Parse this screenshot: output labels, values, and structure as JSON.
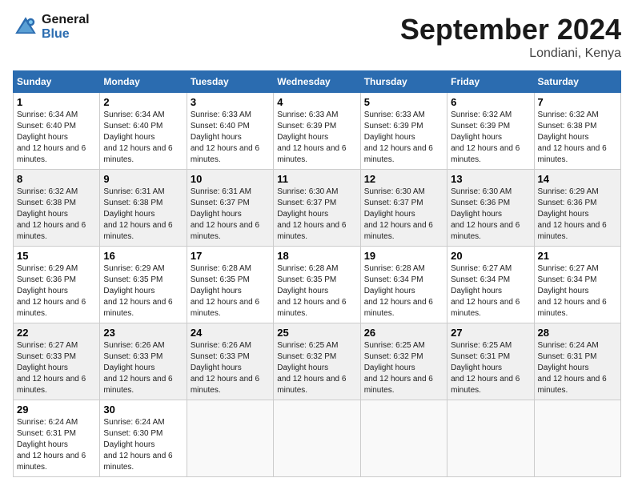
{
  "header": {
    "logo_line1": "General",
    "logo_line2": "Blue",
    "month": "September 2024",
    "location": "Londiani, Kenya"
  },
  "weekdays": [
    "Sunday",
    "Monday",
    "Tuesday",
    "Wednesday",
    "Thursday",
    "Friday",
    "Saturday"
  ],
  "weeks": [
    [
      {
        "day": "1",
        "sunrise": "6:34 AM",
        "sunset": "6:40 PM",
        "daylight": "12 hours and 6 minutes."
      },
      {
        "day": "2",
        "sunrise": "6:34 AM",
        "sunset": "6:40 PM",
        "daylight": "12 hours and 6 minutes."
      },
      {
        "day": "3",
        "sunrise": "6:33 AM",
        "sunset": "6:40 PM",
        "daylight": "12 hours and 6 minutes."
      },
      {
        "day": "4",
        "sunrise": "6:33 AM",
        "sunset": "6:39 PM",
        "daylight": "12 hours and 6 minutes."
      },
      {
        "day": "5",
        "sunrise": "6:33 AM",
        "sunset": "6:39 PM",
        "daylight": "12 hours and 6 minutes."
      },
      {
        "day": "6",
        "sunrise": "6:32 AM",
        "sunset": "6:39 PM",
        "daylight": "12 hours and 6 minutes."
      },
      {
        "day": "7",
        "sunrise": "6:32 AM",
        "sunset": "6:38 PM",
        "daylight": "12 hours and 6 minutes."
      }
    ],
    [
      {
        "day": "8",
        "sunrise": "6:32 AM",
        "sunset": "6:38 PM",
        "daylight": "12 hours and 6 minutes."
      },
      {
        "day": "9",
        "sunrise": "6:31 AM",
        "sunset": "6:38 PM",
        "daylight": "12 hours and 6 minutes."
      },
      {
        "day": "10",
        "sunrise": "6:31 AM",
        "sunset": "6:37 PM",
        "daylight": "12 hours and 6 minutes."
      },
      {
        "day": "11",
        "sunrise": "6:30 AM",
        "sunset": "6:37 PM",
        "daylight": "12 hours and 6 minutes."
      },
      {
        "day": "12",
        "sunrise": "6:30 AM",
        "sunset": "6:37 PM",
        "daylight": "12 hours and 6 minutes."
      },
      {
        "day": "13",
        "sunrise": "6:30 AM",
        "sunset": "6:36 PM",
        "daylight": "12 hours and 6 minutes."
      },
      {
        "day": "14",
        "sunrise": "6:29 AM",
        "sunset": "6:36 PM",
        "daylight": "12 hours and 6 minutes."
      }
    ],
    [
      {
        "day": "15",
        "sunrise": "6:29 AM",
        "sunset": "6:36 PM",
        "daylight": "12 hours and 6 minutes."
      },
      {
        "day": "16",
        "sunrise": "6:29 AM",
        "sunset": "6:35 PM",
        "daylight": "12 hours and 6 minutes."
      },
      {
        "day": "17",
        "sunrise": "6:28 AM",
        "sunset": "6:35 PM",
        "daylight": "12 hours and 6 minutes."
      },
      {
        "day": "18",
        "sunrise": "6:28 AM",
        "sunset": "6:35 PM",
        "daylight": "12 hours and 6 minutes."
      },
      {
        "day": "19",
        "sunrise": "6:28 AM",
        "sunset": "6:34 PM",
        "daylight": "12 hours and 6 minutes."
      },
      {
        "day": "20",
        "sunrise": "6:27 AM",
        "sunset": "6:34 PM",
        "daylight": "12 hours and 6 minutes."
      },
      {
        "day": "21",
        "sunrise": "6:27 AM",
        "sunset": "6:34 PM",
        "daylight": "12 hours and 6 minutes."
      }
    ],
    [
      {
        "day": "22",
        "sunrise": "6:27 AM",
        "sunset": "6:33 PM",
        "daylight": "12 hours and 6 minutes."
      },
      {
        "day": "23",
        "sunrise": "6:26 AM",
        "sunset": "6:33 PM",
        "daylight": "12 hours and 6 minutes."
      },
      {
        "day": "24",
        "sunrise": "6:26 AM",
        "sunset": "6:33 PM",
        "daylight": "12 hours and 6 minutes."
      },
      {
        "day": "25",
        "sunrise": "6:25 AM",
        "sunset": "6:32 PM",
        "daylight": "12 hours and 6 minutes."
      },
      {
        "day": "26",
        "sunrise": "6:25 AM",
        "sunset": "6:32 PM",
        "daylight": "12 hours and 6 minutes."
      },
      {
        "day": "27",
        "sunrise": "6:25 AM",
        "sunset": "6:31 PM",
        "daylight": "12 hours and 6 minutes."
      },
      {
        "day": "28",
        "sunrise": "6:24 AM",
        "sunset": "6:31 PM",
        "daylight": "12 hours and 6 minutes."
      }
    ],
    [
      {
        "day": "29",
        "sunrise": "6:24 AM",
        "sunset": "6:31 PM",
        "daylight": "12 hours and 6 minutes."
      },
      {
        "day": "30",
        "sunrise": "6:24 AM",
        "sunset": "6:30 PM",
        "daylight": "12 hours and 6 minutes."
      },
      null,
      null,
      null,
      null,
      null
    ]
  ]
}
